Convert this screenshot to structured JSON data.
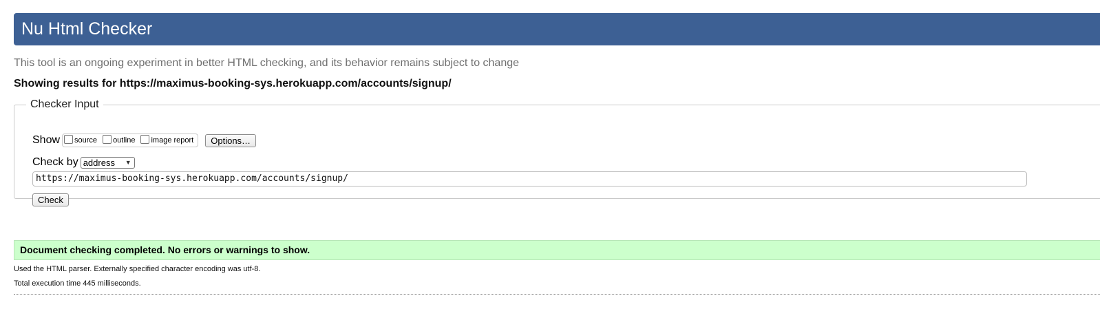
{
  "header": {
    "title": "Nu Html Checker"
  },
  "intro": "This tool is an ongoing experiment in better HTML checking, and its behavior remains subject to change",
  "showing": {
    "prefix": "Showing results for",
    "url": "https://maximus-booking-sys.herokuapp.com/accounts/signup/"
  },
  "checker_input": {
    "legend": "Checker Input",
    "show_label": "Show",
    "show_options": [
      {
        "label": "source",
        "checked": false
      },
      {
        "label": "outline",
        "checked": false
      },
      {
        "label": "image report",
        "checked": false
      }
    ],
    "options_button": "Options…",
    "check_by_label": "Check by",
    "check_by_value": "address",
    "url_value": "https://maximus-booking-sys.herokuapp.com/accounts/signup/",
    "check_button": "Check"
  },
  "result": {
    "message": "Document checking completed. No errors or warnings to show.",
    "status_color": "#ccffcc",
    "details": [
      "Used the HTML parser. Externally specified character encoding was utf-8.",
      "Total execution time 445 milliseconds."
    ]
  },
  "colors": {
    "header_bg": "#3d6094",
    "success_bg": "#ccffcc"
  }
}
